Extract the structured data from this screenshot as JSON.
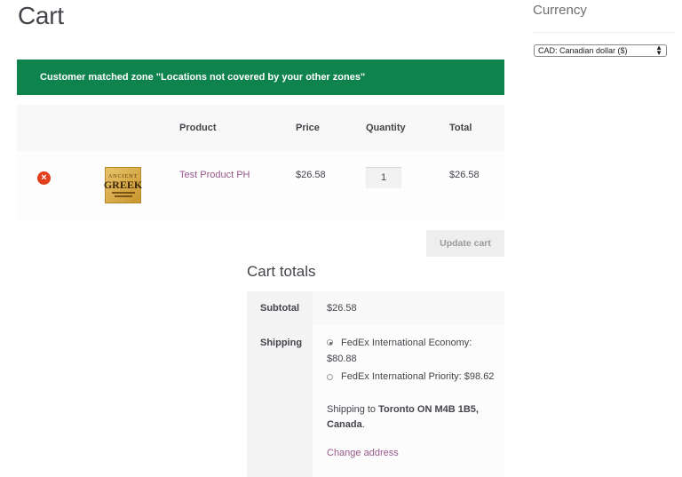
{
  "page": {
    "title": "Cart"
  },
  "sidebar": {
    "currency_title": "Currency",
    "currency_select": {
      "value": "CAD: Canadian dollar ($)"
    }
  },
  "notice": {
    "text": "Customer matched zone \"Locations not covered by your other zones\"",
    "color": "#0f834d"
  },
  "cart_table": {
    "headers": {
      "product": "Product",
      "price": "Price",
      "quantity": "Quantity",
      "total": "Total"
    },
    "rows": [
      {
        "remove_icon": "close-circle-icon",
        "thumbnail": {
          "title": "GREEK"
        },
        "product": "Test Product PH",
        "price": "$26.58",
        "quantity": "1",
        "total": "$26.58"
      }
    ],
    "update_button": "Update cart"
  },
  "cart_totals": {
    "title": "Cart totals",
    "subtotal_label": "Subtotal",
    "subtotal_value": "$26.58",
    "shipping_label": "Shipping",
    "shipping_options": [
      {
        "line1": "FedEx International Economy:",
        "line2": "$80.88",
        "selected": true
      },
      {
        "line1": "FedEx International Priority: $98.62",
        "selected": false
      }
    ],
    "shipping_to_prefix": "Shipping to ",
    "shipping_to_line1": "Toronto ON  M4B 1B5,",
    "shipping_to_line2": "Canada",
    "change_address": "Change address"
  },
  "colors": {
    "link": "#96588a",
    "remove": "#e2401c"
  }
}
